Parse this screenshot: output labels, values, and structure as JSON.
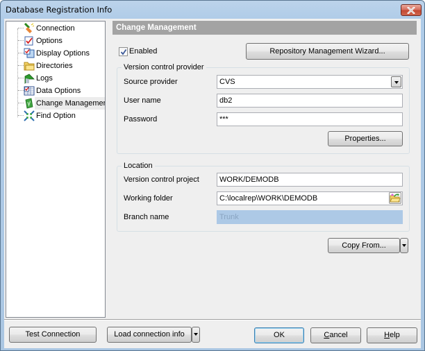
{
  "window": {
    "title": "Database Registration Info",
    "close_icon": "close-icon"
  },
  "tree": {
    "items": [
      {
        "label": "Connection",
        "icon": "plug-icon"
      },
      {
        "label": "Options",
        "icon": "checked-document-icon"
      },
      {
        "label": "Display Options",
        "icon": "display-options-icon"
      },
      {
        "label": "Directories",
        "icon": "folder-icon"
      },
      {
        "label": "Logs",
        "icon": "log-book-icon"
      },
      {
        "label": "Data Options",
        "icon": "data-grid-icon"
      },
      {
        "label": "Change Management",
        "icon": "change-management-icon",
        "selected": true
      },
      {
        "label": "Find Option",
        "icon": "find-arrows-icon"
      }
    ]
  },
  "main": {
    "header": "Change Management",
    "enabled_label": "Enabled",
    "enabled_checked": true,
    "wizard_button": "Repository Management Wizard...",
    "provider_group": {
      "title": "Version control provider",
      "source_provider_label": "Source provider",
      "source_provider_value": "CVS",
      "user_name_label": "User name",
      "user_name_value": "db2",
      "password_label": "Password",
      "password_value": "***",
      "properties_button": "Properties..."
    },
    "location_group": {
      "title": "Location",
      "project_label": "Version control project",
      "project_value": "WORK/DEMODB",
      "working_folder_label": "Working folder",
      "working_folder_value": "C:\\localrep\\WORK\\DEMODB",
      "branch_label": "Branch name",
      "branch_value": "Trunk"
    },
    "copy_from_button": "Copy From..."
  },
  "footer": {
    "test_connection": "Test Connection",
    "load_connection_info": "Load connection info",
    "ok": "OK",
    "cancel_prefix": "C",
    "cancel_rest": "ancel",
    "help_prefix": "H",
    "help_rest": "elp"
  }
}
